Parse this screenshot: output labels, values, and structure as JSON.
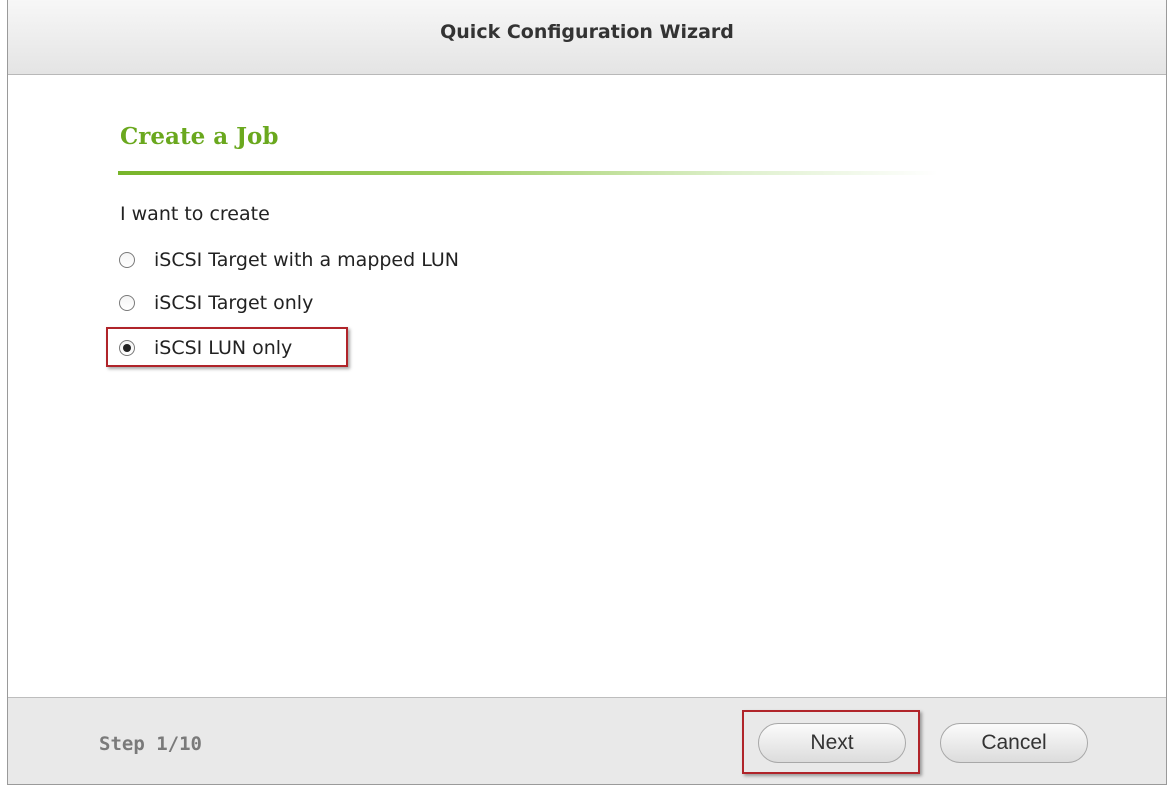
{
  "dialog": {
    "title": "Quick Configuration Wizard"
  },
  "section": {
    "title": "Create a Job",
    "prompt": "I want to create",
    "accent_color": "#6aa81e"
  },
  "options": [
    {
      "label": "iSCSI Target with a mapped LUN",
      "selected": false
    },
    {
      "label": "iSCSI Target only",
      "selected": false
    },
    {
      "label": "iSCSI LUN only",
      "selected": true
    }
  ],
  "footer": {
    "step": "Step 1/10",
    "next_label": "Next",
    "cancel_label": "Cancel"
  },
  "annotation_color": "#b0242a"
}
